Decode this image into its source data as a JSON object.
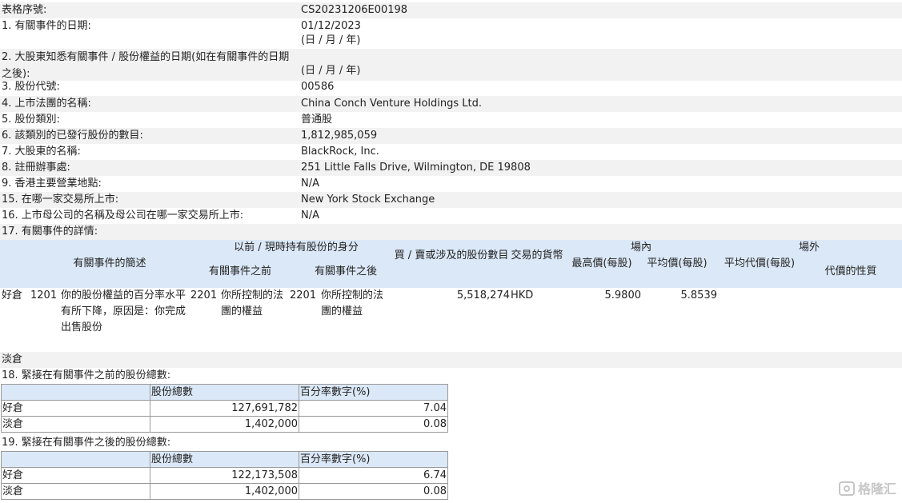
{
  "form": {
    "serial_label": "表格序號:",
    "serial_value": "CS20231206E00198",
    "f1_label": "1. 有關事件的日期:",
    "f1_value": "01/12/2023",
    "f1_format": "(日 / 月 / 年)",
    "f2_label": "2. 大股東知悉有關事件 / 股份權益的日期(如在有關事件的日期之後):",
    "f2_value": "(日 / 月 / 年)",
    "f3_label": "3. 股份代號:",
    "f3_value": "00586",
    "f4_label": "4. 上市法團的名稱:",
    "f4_value": "China Conch Venture Holdings Ltd.",
    "f5_label": "5. 股份類別:",
    "f5_value": "普通股",
    "f6_label": "6. 該類別的已發行股份的數目:",
    "f6_value": "1,812,985,059",
    "f7_label": "7. 大股東的名稱:",
    "f7_value": "BlackRock, Inc.",
    "f8_label": "8. 註冊辦事處:",
    "f8_value": "251 Little Falls Drive, Wilmington, DE 19808",
    "f9_label": "9. 香港主要營業地點:",
    "f9_value": "N/A",
    "f15_label": "15. 在哪一家交易所上市:",
    "f15_value": "New York Stock Exchange",
    "f16_label": "16. 上市母公司的名稱及母公司在哪一家交易所上市:",
    "f16_value": "N/A",
    "f17_label": "17. 有關事件的詳情:"
  },
  "event_table": {
    "headers": {
      "desc": "有關事件的簡述",
      "capacity_group": "以前 / 現時持有股份的身分",
      "before": "有關事件之前",
      "after": "有關事件之後",
      "shares": "買 / 賣或涉及的股份數目",
      "currency": "交易的貨幣",
      "on_exchange": "場內",
      "high": "最高價(每股)",
      "avg": "平均價(每股)",
      "off_exchange": "場外",
      "off_avg": "平均代價(每股)",
      "consideration": "代價的性質"
    },
    "row": {
      "position": "好倉",
      "code": "1201",
      "desc": "你的股份權益的百分率水平有所下降，原因是：你完成出售股份",
      "before_code": "2201",
      "before_text": "你所控制的法團的權益",
      "after_code": "2201",
      "after_text": "你所控制的法團的權益",
      "shares": "5,518,274",
      "currency": "HKD",
      "high": "5.9800",
      "avg": "5.8539"
    },
    "short_label": "淡倉"
  },
  "holdings_before": {
    "title": "18. 緊接在有關事件之前的股份總數:",
    "col_shares": "股份總數",
    "col_pct": "百分率數字(%)",
    "rows": [
      {
        "label": "好倉",
        "shares": "127,691,782",
        "pct": "7.04"
      },
      {
        "label": "淡倉",
        "shares": "1,402,000",
        "pct": "0.08"
      }
    ]
  },
  "holdings_after": {
    "title": "19. 緊接在有關事件之後的股份總數:",
    "col_shares": "股份總數",
    "col_pct": "百分率數字(%)",
    "rows": [
      {
        "label": "好倉",
        "shares": "122,173,508",
        "pct": "6.74"
      },
      {
        "label": "淡倉",
        "shares": "1,402,000",
        "pct": "0.08"
      }
    ]
  },
  "watermark": {
    "text": "格隆汇",
    "icon": "gelonghui-logo-icon"
  }
}
